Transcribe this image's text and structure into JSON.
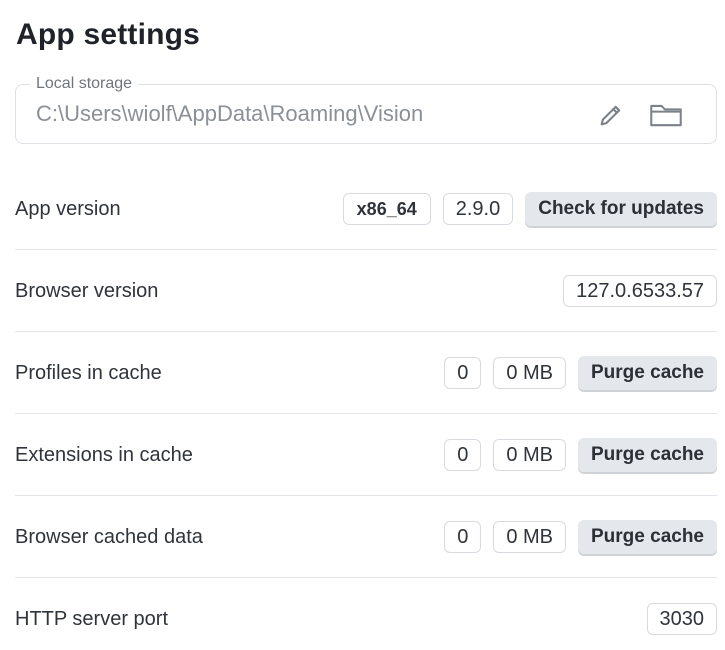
{
  "page": {
    "title": "App settings"
  },
  "storage": {
    "legend": "Local storage",
    "path": "C:\\Users\\wiolf\\AppData\\Roaming\\Vision",
    "edit_icon": "pencil-icon",
    "folder_icon": "folder-icon"
  },
  "rows": {
    "app_version": {
      "label": "App version",
      "arch": "x86_64",
      "version": "2.9.0",
      "button": "Check for updates"
    },
    "browser_version": {
      "label": "Browser version",
      "value": "127.0.6533.57"
    },
    "profiles_cache": {
      "label": "Profiles in cache",
      "count": "0",
      "size": "0 MB",
      "button": "Purge cache"
    },
    "extensions_cache": {
      "label": "Extensions in cache",
      "count": "0",
      "size": "0 MB",
      "button": "Purge cache"
    },
    "browser_cached": {
      "label": "Browser cached data",
      "count": "0",
      "size": "0 MB",
      "button": "Purge cache"
    },
    "http_port": {
      "label": "HTTP server port",
      "value": "3030"
    }
  },
  "colors": {
    "button_bg": "#e4e7eb",
    "border": "#d7dbe0",
    "muted_text": "#8a9097"
  }
}
